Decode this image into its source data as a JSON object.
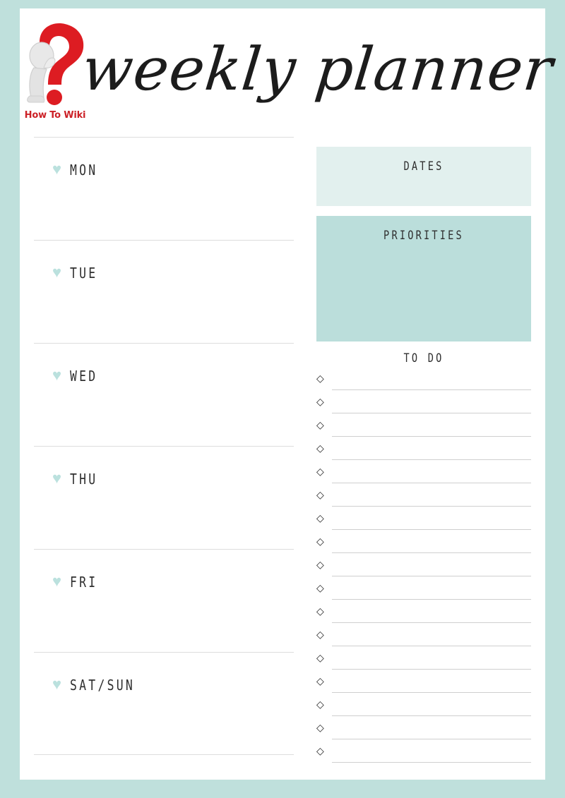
{
  "page": {
    "border_color": "#bfe0dc",
    "sheet_color": "#ffffff"
  },
  "header": {
    "logo": {
      "icon": "question-mark-thinker-logo",
      "caption": "How To Wiki",
      "caption_color": "#cc2127"
    },
    "title": "weekly planner"
  },
  "days": {
    "bullet_icon": "heart-icon",
    "bullet_glyph": "♥",
    "bullet_color": "#bbe1de",
    "items": [
      {
        "label": "MON"
      },
      {
        "label": "TUE"
      },
      {
        "label": "WED"
      },
      {
        "label": "THU"
      },
      {
        "label": "FRI"
      },
      {
        "label": "SAT/SUN"
      }
    ]
  },
  "sidebar": {
    "dates": {
      "heading": "DATES",
      "background": "#e2f0ee"
    },
    "priorities": {
      "heading": "PRIORITIES",
      "background": "#bbdedb"
    },
    "todo": {
      "heading": "TO DO",
      "bullet_icon": "diamond-icon",
      "bullet_glyph": "◇",
      "rows": [
        {
          "value": ""
        },
        {
          "value": ""
        },
        {
          "value": ""
        },
        {
          "value": ""
        },
        {
          "value": ""
        },
        {
          "value": ""
        },
        {
          "value": ""
        },
        {
          "value": ""
        },
        {
          "value": ""
        },
        {
          "value": ""
        },
        {
          "value": ""
        },
        {
          "value": ""
        },
        {
          "value": ""
        },
        {
          "value": ""
        },
        {
          "value": ""
        },
        {
          "value": ""
        },
        {
          "value": ""
        }
      ]
    }
  }
}
